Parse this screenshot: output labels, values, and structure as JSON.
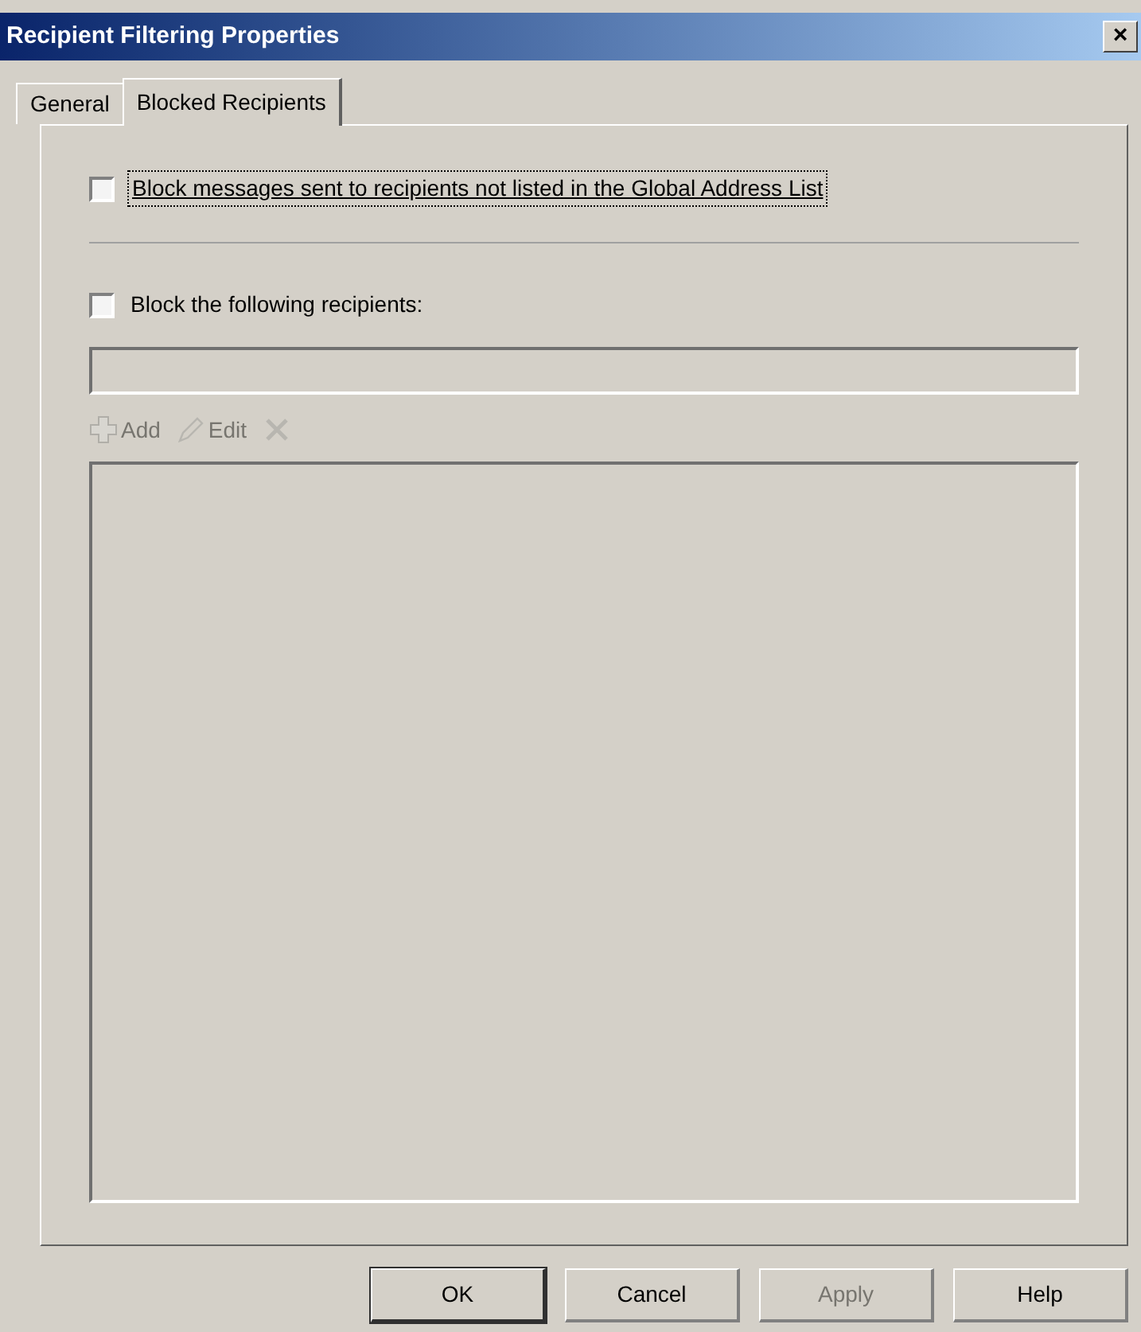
{
  "window": {
    "title": "Recipient Filtering Properties",
    "close": "×"
  },
  "tabs": [
    {
      "label": "General",
      "selected": false
    },
    {
      "label": "Blocked Recipients",
      "selected": true
    }
  ],
  "options": [
    {
      "label": "Block messages sent to recipients not listed in the Global Address List",
      "checked": false,
      "focused": true
    },
    {
      "label": "Block the following recipients:",
      "checked": false,
      "focused": false
    }
  ],
  "recipient_input": {
    "disabled": true
  },
  "toolbar": [
    {
      "kind": "add",
      "label": "Add",
      "disabled": true
    },
    {
      "kind": "edit",
      "label": "Edit",
      "disabled": true
    },
    {
      "kind": "delete",
      "disabled": true
    }
  ],
  "buttons": [
    {
      "label": "OK",
      "disabled": false,
      "default": true
    },
    {
      "label": "Cancel",
      "disabled": false,
      "default": false
    },
    {
      "label": "Apply",
      "disabled": true,
      "default": false
    },
    {
      "label": "Help",
      "disabled": false,
      "default": false
    }
  ]
}
